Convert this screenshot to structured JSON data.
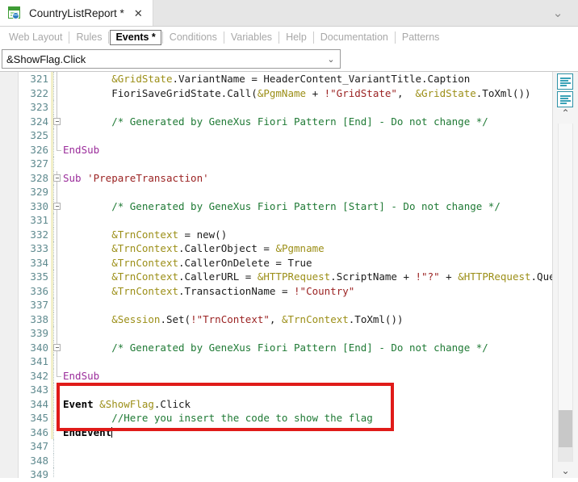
{
  "window": {
    "tab": {
      "title": "CountryListReport *",
      "close_label": "✕",
      "icon": "web-panel-icon"
    },
    "collapse_chevron": "⌄"
  },
  "section_tabs": [
    {
      "label": "Web Layout",
      "active": false
    },
    {
      "label": "Rules",
      "active": false
    },
    {
      "label": "Events *",
      "active": true
    },
    {
      "label": "Conditions",
      "active": false
    },
    {
      "label": "Variables",
      "active": false
    },
    {
      "label": "Help",
      "active": false
    },
    {
      "label": "Documentation",
      "active": false
    },
    {
      "label": "Patterns",
      "active": false
    }
  ],
  "event_combo": {
    "value": "&ShowFlag.Click",
    "arrow": "⌄"
  },
  "right_gutter": {
    "outline_icon_1": "code-outline-icon",
    "outline_icon_2": "code-structure-icon",
    "scroll_up": "⌃",
    "scroll_down": "⌄"
  },
  "annotation": {
    "highlight_color": "#e01b19"
  },
  "editor": {
    "first_line_number": 321,
    "lines": [
      {
        "n": 321,
        "fold": "line",
        "change": true,
        "tokens": [
          {
            "t": "        ",
            "c": "plain"
          },
          {
            "t": "&GridState",
            "c": "var"
          },
          {
            "t": ".VariantName = HeaderContent_VariantTitle.Caption",
            "c": "plain"
          }
        ]
      },
      {
        "n": 322,
        "fold": "line",
        "change": true,
        "tokens": [
          {
            "t": "        FioriSaveGridState.Call(",
            "c": "plain"
          },
          {
            "t": "&PgmName",
            "c": "var"
          },
          {
            "t": " + ",
            "c": "plain"
          },
          {
            "t": "!\"GridState\"",
            "c": "str"
          },
          {
            "t": ",  ",
            "c": "plain"
          },
          {
            "t": "&GridState",
            "c": "var"
          },
          {
            "t": ".ToXml())",
            "c": "plain"
          }
        ]
      },
      {
        "n": 323,
        "fold": "line",
        "change": true,
        "tokens": []
      },
      {
        "n": 324,
        "fold": "box",
        "change": true,
        "tokens": [
          {
            "t": "        /* Generated by GeneXus Fiori Pattern [End] - Do not change */",
            "c": "cmt"
          }
        ]
      },
      {
        "n": 325,
        "fold": "line",
        "change": true,
        "tokens": []
      },
      {
        "n": 326,
        "fold": "end",
        "change": true,
        "tokens": [
          {
            "t": "EndSub",
            "c": "kw"
          }
        ]
      },
      {
        "n": 327,
        "fold": "dot",
        "change": true,
        "tokens": []
      },
      {
        "n": 328,
        "fold": "box",
        "change": true,
        "tokens": [
          {
            "t": "Sub",
            "c": "kw"
          },
          {
            "t": " ",
            "c": "plain"
          },
          {
            "t": "'PrepareTransaction'",
            "c": "str"
          }
        ]
      },
      {
        "n": 329,
        "fold": "line",
        "change": true,
        "tokens": []
      },
      {
        "n": 330,
        "fold": "box",
        "change": true,
        "tokens": [
          {
            "t": "        /* Generated by GeneXus Fiori Pattern [Start] - Do not change */",
            "c": "cmt"
          }
        ]
      },
      {
        "n": 331,
        "fold": "line",
        "change": true,
        "tokens": []
      },
      {
        "n": 332,
        "fold": "line",
        "change": true,
        "tokens": [
          {
            "t": "        ",
            "c": "plain"
          },
          {
            "t": "&TrnContext",
            "c": "var"
          },
          {
            "t": " = new()",
            "c": "plain"
          }
        ]
      },
      {
        "n": 333,
        "fold": "line",
        "change": true,
        "tokens": [
          {
            "t": "        ",
            "c": "plain"
          },
          {
            "t": "&TrnContext",
            "c": "var"
          },
          {
            "t": ".CallerObject = ",
            "c": "plain"
          },
          {
            "t": "&Pgmname",
            "c": "var"
          }
        ]
      },
      {
        "n": 334,
        "fold": "line",
        "change": true,
        "tokens": [
          {
            "t": "        ",
            "c": "plain"
          },
          {
            "t": "&TrnContext",
            "c": "var"
          },
          {
            "t": ".CallerOnDelete = True",
            "c": "plain"
          }
        ]
      },
      {
        "n": 335,
        "fold": "line",
        "change": true,
        "tokens": [
          {
            "t": "        ",
            "c": "plain"
          },
          {
            "t": "&TrnContext",
            "c": "var"
          },
          {
            "t": ".CallerURL = ",
            "c": "plain"
          },
          {
            "t": "&HTTPRequest",
            "c": "var"
          },
          {
            "t": ".ScriptName + ",
            "c": "plain"
          },
          {
            "t": "!\"?\"",
            "c": "str"
          },
          {
            "t": " + ",
            "c": "plain"
          },
          {
            "t": "&HTTPRequest",
            "c": "var"
          },
          {
            "t": ".Quer",
            "c": "plain"
          }
        ]
      },
      {
        "n": 336,
        "fold": "line",
        "change": true,
        "tokens": [
          {
            "t": "        ",
            "c": "plain"
          },
          {
            "t": "&TrnContext",
            "c": "var"
          },
          {
            "t": ".TransactionName = ",
            "c": "plain"
          },
          {
            "t": "!\"Country\"",
            "c": "str"
          }
        ]
      },
      {
        "n": 337,
        "fold": "line",
        "change": true,
        "tokens": []
      },
      {
        "n": 338,
        "fold": "line",
        "change": true,
        "tokens": [
          {
            "t": "        ",
            "c": "plain"
          },
          {
            "t": "&Session",
            "c": "var"
          },
          {
            "t": ".Set(",
            "c": "plain"
          },
          {
            "t": "!\"TrnContext\"",
            "c": "str"
          },
          {
            "t": ", ",
            "c": "plain"
          },
          {
            "t": "&TrnContext",
            "c": "var"
          },
          {
            "t": ".ToXml())",
            "c": "plain"
          }
        ]
      },
      {
        "n": 339,
        "fold": "line",
        "change": true,
        "tokens": []
      },
      {
        "n": 340,
        "fold": "box",
        "change": true,
        "tokens": [
          {
            "t": "        /* Generated by GeneXus Fiori Pattern [End] - Do not change */",
            "c": "cmt"
          }
        ]
      },
      {
        "n": 341,
        "fold": "line",
        "change": true,
        "tokens": []
      },
      {
        "n": 342,
        "fold": "end",
        "change": true,
        "tokens": [
          {
            "t": "EndSub",
            "c": "kw"
          }
        ]
      },
      {
        "n": 343,
        "fold": "dot",
        "change": true,
        "tokens": []
      },
      {
        "n": 344,
        "fold": "dot",
        "change": true,
        "tokens": [
          {
            "t": "Event",
            "c": "bold"
          },
          {
            "t": " ",
            "c": "plain"
          },
          {
            "t": "&ShowFlag",
            "c": "var"
          },
          {
            "t": ".Click",
            "c": "plain"
          }
        ]
      },
      {
        "n": 345,
        "fold": "dot",
        "change": true,
        "tokens": [
          {
            "t": "        //Here you insert the code to show the flag",
            "c": "cmt"
          }
        ]
      },
      {
        "n": 346,
        "fold": "dot",
        "change": true,
        "caret": true,
        "tokens": [
          {
            "t": "EndEvent",
            "c": "bold"
          }
        ]
      },
      {
        "n": 347,
        "fold": "dot",
        "change": false,
        "tokens": []
      },
      {
        "n": 348,
        "fold": "dot",
        "change": false,
        "tokens": []
      },
      {
        "n": 349,
        "fold": "dot",
        "change": false,
        "tokens": []
      }
    ]
  }
}
